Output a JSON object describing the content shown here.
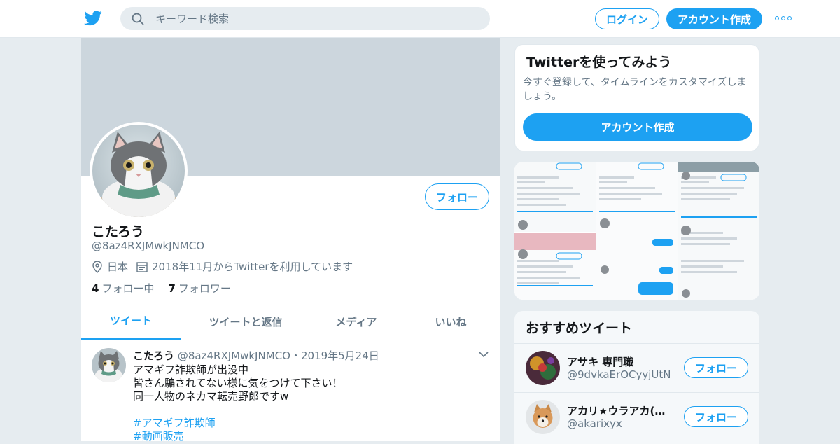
{
  "header": {
    "search_placeholder": "キーワード検索",
    "login_label": "ログイン",
    "signup_label": "アカウント作成"
  },
  "profile": {
    "name": "こたろう",
    "handle": "@8az4RXJMwkJNMCO",
    "location": "日本",
    "joined": "2018年11月からTwitterを利用しています",
    "following_count": "4",
    "following_label": "フォロー中",
    "followers_count": "7",
    "followers_label": "フォロワー",
    "follow_label": "フォロー"
  },
  "tabs": [
    {
      "label": "ツイート"
    },
    {
      "label": "ツイートと返信"
    },
    {
      "label": "メディア"
    },
    {
      "label": "いいね"
    }
  ],
  "tweet": {
    "name": "こたろう",
    "handle": "@8az4RXJMwkJNMCO",
    "separator": "・",
    "date": "2019年5月24日",
    "lines": [
      "アマギフ詐欺師が出没中",
      "皆さん騙されてない様に気をつけて下さい！",
      "同一人物のネカマ転売野郎ですw",
      ""
    ],
    "hashtags": [
      "#アマギフ詐欺師",
      "#動画販売"
    ]
  },
  "sidebar": {
    "signup_card": {
      "title": "Twitterを使ってみよう",
      "text": "今すぐ登録して、タイムラインをカスタマイズしましょう。",
      "button": "アカウント作成"
    },
    "recommend_title": "おすすめツイート",
    "recommend": [
      {
        "name": "アサキ 専門職",
        "handle": "@9dvkaErOCyyjUtN",
        "button": "フォロー"
      },
      {
        "name": "アカリ★ウラアカ(前…",
        "handle": "@akarixyx",
        "button": "フォロー"
      }
    ]
  },
  "colors": {
    "accent": "#1da1f2",
    "banner": "#ccd6dd",
    "background": "#e6ecf0",
    "muted_text": "#657786"
  }
}
